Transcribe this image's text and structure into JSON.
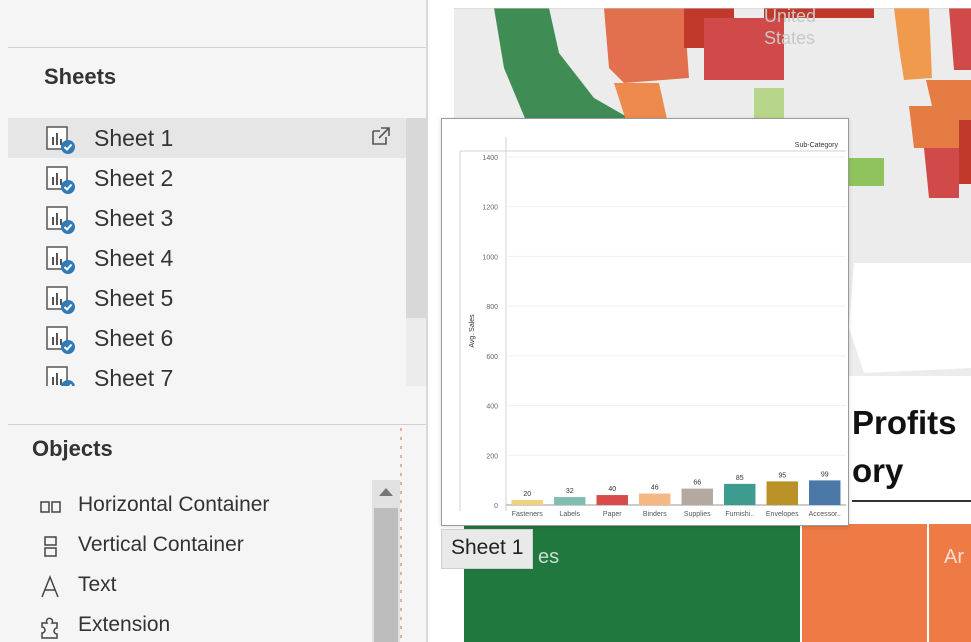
{
  "sheets_panel": {
    "title": "Sheets",
    "items": [
      {
        "label": "Sheet 1",
        "active": true
      },
      {
        "label": "Sheet 2",
        "active": false
      },
      {
        "label": "Sheet 3",
        "active": false
      },
      {
        "label": "Sheet 4",
        "active": false
      },
      {
        "label": "Sheet 5",
        "active": false
      },
      {
        "label": "Sheet 6",
        "active": false
      },
      {
        "label": "Sheet 7",
        "active": false
      }
    ]
  },
  "objects_panel": {
    "title": "Objects",
    "items": [
      {
        "label": "Horizontal Container",
        "icon": "horizontal-container-icon"
      },
      {
        "label": "Vertical Container",
        "icon": "vertical-container-icon"
      },
      {
        "label": "Text",
        "icon": "text-icon"
      },
      {
        "label": "Extension",
        "icon": "extension-icon"
      }
    ]
  },
  "dashboard": {
    "map_labels": [
      "United",
      "States"
    ],
    "heading_line1": "Profits",
    "heading_line2": "ory",
    "treemap_labels": [
      "es",
      "Ar"
    ]
  },
  "hover_tab": {
    "label": "Sheet 1"
  },
  "colors": {
    "accent_blue": "#2e7bb5",
    "map_green": "#3f8c55",
    "map_red": "#d14a4a",
    "map_orange": "#ef8a4f",
    "treemap_green": "#21783f",
    "treemap_orange": "#ee7b45"
  },
  "chart_data": {
    "type": "bar",
    "title": "",
    "header_label": "Sub-Category",
    "ylabel": "Avg. Sales",
    "xlabel": "",
    "ylim": [
      0,
      1400
    ],
    "yticks": [
      0,
      200,
      400,
      600,
      800,
      1000,
      1200,
      1400
    ],
    "categories": [
      "Fasteners",
      "Labels",
      "Paper",
      "Binders",
      "Supplies",
      "Furnishi..",
      "Envelopes",
      "Accessor.."
    ],
    "values": [
      20,
      32,
      40,
      46,
      66,
      85,
      95,
      99
    ],
    "colors": [
      "#f1d07e",
      "#80bdb0",
      "#d94a4a",
      "#f6b882",
      "#b3a9a0",
      "#3d9c8f",
      "#b99126",
      "#4a79a7"
    ]
  }
}
